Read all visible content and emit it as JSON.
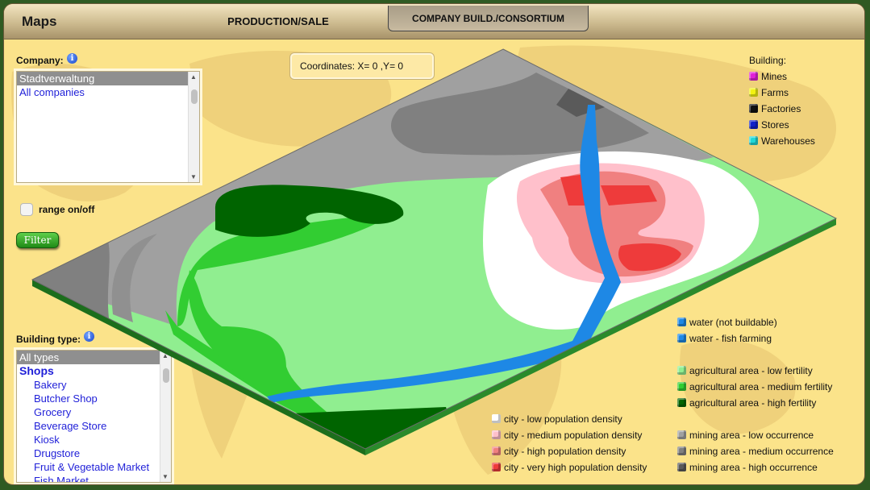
{
  "header": {
    "title": "Maps",
    "tabs": [
      {
        "label": "PRODUCTION/SALE",
        "active": false
      },
      {
        "label": "COMPANY BUILD./CONSORTIUM",
        "active": true
      }
    ]
  },
  "company": {
    "label": "Company:",
    "items": [
      "Stadtverwaltung",
      "All companies"
    ],
    "selected": "Stadtverwaltung"
  },
  "range": {
    "label": "range on/off",
    "checked": false
  },
  "filter_button": "Filter",
  "building_type": {
    "label": "Building type:",
    "items": [
      "All types",
      "Shops",
      "Bakery",
      "Butcher Shop",
      "Grocery",
      "Beverage Store",
      "Kiosk",
      "Drugstore",
      "Fruit & Vegetable Market",
      "Fish Market"
    ],
    "selected": "All types"
  },
  "coordinates": "Coordinates: X= 0 ,Y= 0",
  "building_legend": {
    "title": "Building:",
    "items": [
      {
        "label": "Mines",
        "color": "#e020d8"
      },
      {
        "label": "Farms",
        "color": "#f2f213"
      },
      {
        "label": "Factories",
        "color": "#111111"
      },
      {
        "label": "Stores",
        "color": "#1020c8"
      },
      {
        "label": "Warehouses",
        "color": "#20d8d8"
      }
    ]
  },
  "terrain_legend": {
    "water": [
      {
        "label": "water (not buildable)",
        "color": "#1e88e5"
      },
      {
        "label": "water - fish farming",
        "color": "#1e88e5"
      }
    ],
    "agricultural": [
      {
        "label": "agricultural area - low fertility",
        "color": "#90ee90"
      },
      {
        "label": "agricultural area - medium fertility",
        "color": "#32cd32"
      },
      {
        "label": "agricultural area - high fertility",
        "color": "#006400"
      }
    ],
    "city": [
      {
        "label": "city - low population density",
        "color": "#ffffff"
      },
      {
        "label": "city - medium population density",
        "color": "#ffc0cb"
      },
      {
        "label": "city - high population density",
        "color": "#f08080"
      },
      {
        "label": "city - very high population density",
        "color": "#ee3b3b"
      }
    ],
    "mining": [
      {
        "label": "mining area - low occurrence",
        "color": "#a0a0a0"
      },
      {
        "label": "mining area - medium occurrence",
        "color": "#808080"
      },
      {
        "label": "mining area - high occurrence",
        "color": "#5a5a5a"
      }
    ]
  }
}
